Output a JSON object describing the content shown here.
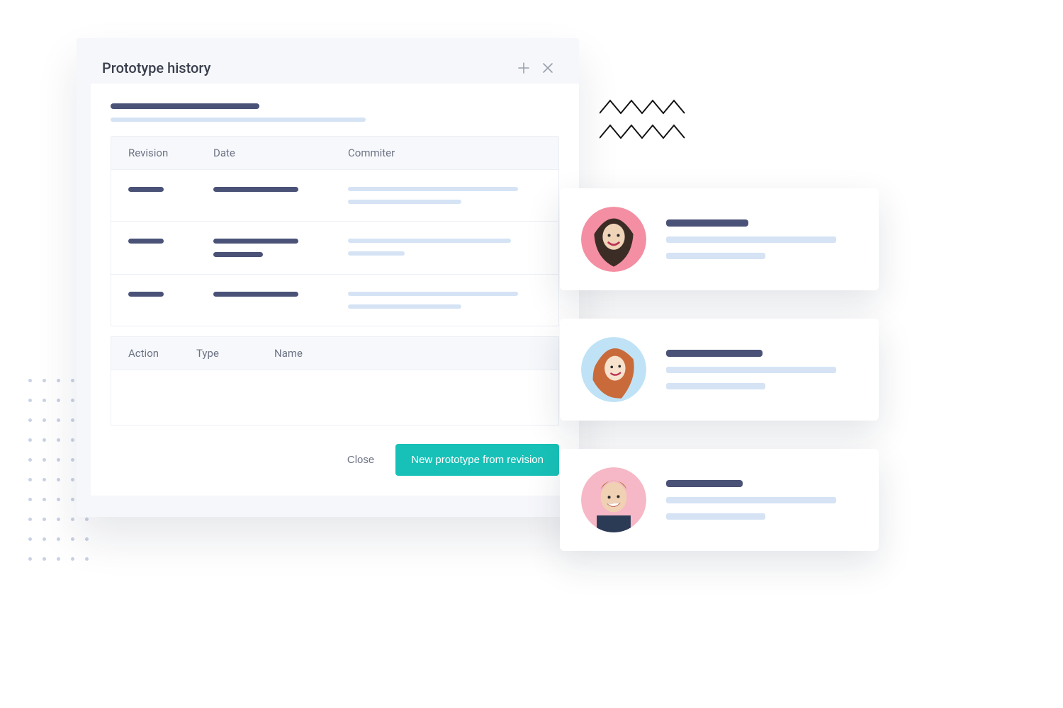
{
  "panel": {
    "title": "Prototype history",
    "table1": {
      "headers": {
        "revision": "Revision",
        "date": "Date",
        "commiter": "Commiter"
      }
    },
    "table2": {
      "headers": {
        "action": "Action",
        "type": "Type",
        "name": "Name"
      }
    },
    "footer": {
      "close": "Close",
      "primary": "New prototype from revision"
    }
  },
  "colors": {
    "accent": "#18c1b7",
    "dark_bar": "#4a5277",
    "light_bar": "#d5e3f5"
  }
}
